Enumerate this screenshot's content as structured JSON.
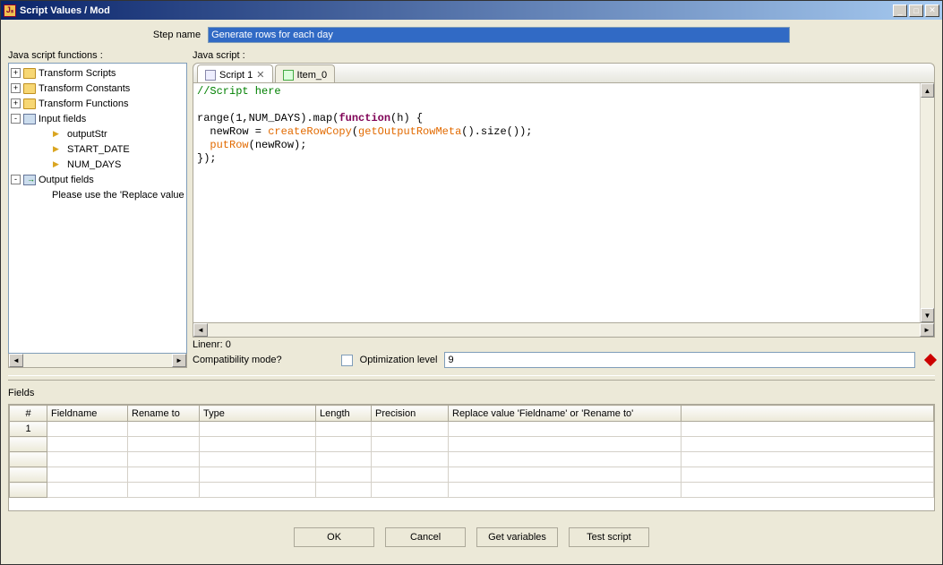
{
  "window": {
    "title": "Script Values / Mod"
  },
  "stepname": {
    "label": "Step name",
    "value": "Generate rows for each day"
  },
  "left": {
    "label": "Java script functions :",
    "tree": [
      {
        "exp": "+",
        "icon": "folder",
        "label": "Transform Scripts",
        "depth": 0
      },
      {
        "exp": "+",
        "icon": "folder",
        "label": "Transform Constants",
        "depth": 0
      },
      {
        "exp": "+",
        "icon": "folder",
        "label": "Transform Functions",
        "depth": 0
      },
      {
        "exp": "-",
        "icon": "doc",
        "label": "Input fields",
        "depth": 0
      },
      {
        "exp": "",
        "icon": "field",
        "label": "outputStr",
        "depth": 2
      },
      {
        "exp": "",
        "icon": "field",
        "label": "START_DATE",
        "depth": 2
      },
      {
        "exp": "",
        "icon": "field",
        "label": "NUM_DAYS",
        "depth": 2
      },
      {
        "exp": "-",
        "icon": "out",
        "label": "Output fields",
        "depth": 0
      },
      {
        "exp": "",
        "icon": "",
        "label": "Please use the 'Replace value",
        "depth": 2
      }
    ]
  },
  "right": {
    "label": "Java script :",
    "tabs": [
      {
        "label": "Script 1",
        "closable": true,
        "icon": "script"
      },
      {
        "label": "Item_0",
        "closable": false,
        "icon": "item"
      }
    ],
    "linenr_label": "Linenr:",
    "linenr_value": "0",
    "compat_label": "Compatibility mode?",
    "opt_label": "Optimization level",
    "opt_value": "9",
    "code": {
      "l1": "//Script here",
      "l2": "",
      "l3a": "range(1,NUM_DAYS).map(",
      "l3b": "function",
      "l3c": "(h) {",
      "l4a": "  newRow = ",
      "l4b": "createRowCopy",
      "l4c": "(",
      "l4d": "getOutputRowMeta",
      "l4e": "().size());",
      "l5a": "  ",
      "l5b": "putRow",
      "l5c": "(newRow);",
      "l6": "});"
    }
  },
  "fields": {
    "label": "Fields",
    "headers": [
      "#",
      "Fieldname",
      "Rename to",
      "Type",
      "Length",
      "Precision",
      "Replace value 'Fieldname' or 'Rename to'",
      ""
    ],
    "rows": [
      {
        "num": "1"
      }
    ]
  },
  "buttons": {
    "ok": "OK",
    "cancel": "Cancel",
    "getvars": "Get variables",
    "test": "Test script"
  }
}
